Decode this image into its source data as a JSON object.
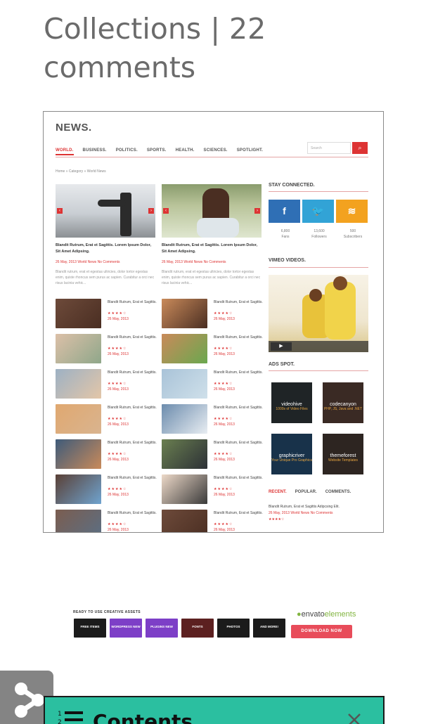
{
  "page_title": "Collections | 22 comments",
  "screenshot": {
    "brand": "NEWS.",
    "nav": [
      "WORLD.",
      "BUSINESS.",
      "POLITICS.",
      "SPORTS.",
      "HEALTH.",
      "SCIENCES.",
      "SPOTLIGHT."
    ],
    "search_placeholder": "Search",
    "breadcrumb": "Home  »  Category  »  World News",
    "hero_title": "Blandit Rutrum, Erat et Sagittis. Lorem Ipsum Dolor, Sit Amet Adipsing.",
    "hero_meta": "26 May, 2013   World News   No Comments",
    "hero_excerpt": "Blandit rutrum, erat et egestas ultricies, dolor tortor egestas enim, quiste rhoncus sem purus ac sapien. Curabitur a orci nec risus lacinia vehic...",
    "item_title": "Blandit Rutrum, Erat et Sagittis.",
    "item_date": "26 May, 2013",
    "item_stars": "★★★★☆",
    "side": {
      "stay_connected": "STAY CONNECTED.",
      "social": [
        {
          "icon": "f",
          "count": "6,800",
          "label": "Fans",
          "color": "#2f6fb5"
        },
        {
          "icon": "🐦",
          "count": "13,600",
          "label": "Followers",
          "color": "#32a3d6"
        },
        {
          "icon": "≋",
          "count": "500",
          "label": "Subscribers",
          "color": "#f3a21f"
        }
      ],
      "vimeo": "VIMEO VIDEOS.",
      "ads": "ADS SPOT.",
      "ad_tiles": [
        {
          "name": "videohive",
          "sub": "1000s of Video Files"
        },
        {
          "name": "codecanyon",
          "sub": "PHP, JS, Java and .NET"
        },
        {
          "name": "graphicriver",
          "sub": "Your Unique Pro Graphics"
        },
        {
          "name": "themeforest",
          "sub": "Website Templates"
        }
      ],
      "tabs": [
        "RECENT.",
        "POPULAR.",
        "COMMENTS."
      ],
      "recent_text": "Blandit Rutrum, Erat et Sagittis Adipcsing Elit.",
      "recent_meta": "26 May, 2013  World News  No Comments"
    }
  },
  "banner": {
    "top_text": "READY TO USE CREATIVE ASSETS",
    "tiles": [
      {
        "label": "FREE ITEMS",
        "style": ""
      },
      {
        "label": "WORDPRESS NEW",
        "style": "p"
      },
      {
        "label": "PLUGINS NEW",
        "style": "p"
      },
      {
        "label": "FONTS",
        "style": "r"
      },
      {
        "label": "PHOTOS",
        "style": ""
      },
      {
        "label": "AND MORE!",
        "style": ""
      }
    ],
    "logo_a": "envato",
    "logo_b": "elements",
    "button": "DOWNLOAD NOW"
  },
  "contents_label": "Contents",
  "colors": {
    "accent": "#2bbfa0",
    "news_red": "#dd3333"
  }
}
